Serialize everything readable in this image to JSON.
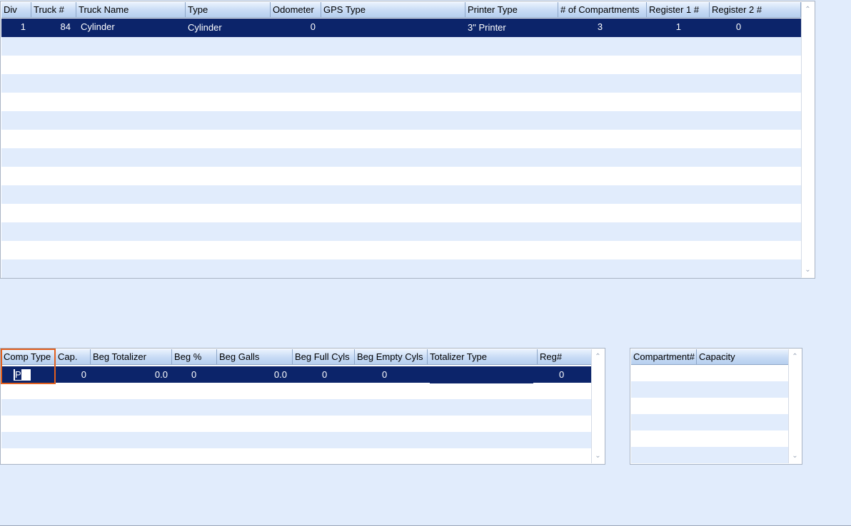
{
  "trucks_grid": {
    "columns": [
      "Div",
      "Truck #",
      "Truck Name",
      "Type",
      "Odometer",
      "GPS Type",
      "Printer Type",
      "# of Compartments",
      "Register 1 #",
      "Register 2 #"
    ],
    "rows": [
      {
        "div": "1",
        "truck_no": "84",
        "truck_name": "Cylinder",
        "type": "Cylinder",
        "odometer": "0",
        "gps_type": "",
        "printer_type": "3\" Printer",
        "compartments": "3",
        "register1": "1",
        "register2": "0"
      }
    ]
  },
  "comp_grid": {
    "columns": [
      "Comp Type",
      "Cap.",
      "Beg Totalizer",
      "Beg %",
      "Beg Galls",
      "Beg Full Cyls",
      "Beg Empty Cyls",
      "Totalizer Type",
      "Reg#"
    ],
    "rows": [
      {
        "comp_type": "P",
        "cap": "0",
        "beg_totalizer": "0.0",
        "beg_pct": "0",
        "beg_galls": "0.0",
        "beg_full": "0",
        "beg_empty": "0",
        "totalizer_type": "",
        "reg": "0"
      }
    ]
  },
  "capacity_grid": {
    "columns": [
      "Compartment#",
      "Capacity"
    ],
    "rows": []
  },
  "colors": {
    "selected_row": "#0c246a",
    "focus_border": "#e2601f",
    "alt_row": "#e1ecfc",
    "background": "#e1ecfc"
  },
  "icons": {
    "scroll_down": "chevron-down-icon"
  }
}
